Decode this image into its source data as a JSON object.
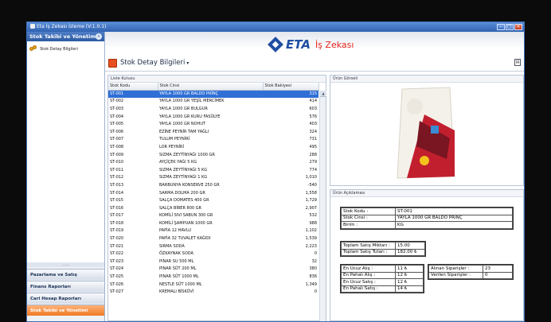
{
  "window": {
    "title": "Eta İş Zekası İzleme (V:1.0.1)"
  },
  "sidebar": {
    "title": "Stok Takibi ve Yönetimi",
    "items": [
      {
        "label": "Stok Detay Bilgileri"
      }
    ],
    "grip": "......",
    "buttons": [
      {
        "label": "Pazarlama ve Satış"
      },
      {
        "label": "Finans Raporları"
      },
      {
        "label": "Cari Hesap Raporları"
      },
      {
        "label": "Stok Takibi ve Yönetimi"
      }
    ]
  },
  "header": {
    "brand": "ETA",
    "tagline": "İş Zekası"
  },
  "page": {
    "title": "Stok Detay Bilgileri"
  },
  "list": {
    "title": "Liste Kutusu",
    "columns": [
      "Stok Kodu",
      "Stok Cinsi",
      "Stok Bakiyesi"
    ],
    "rows": [
      [
        "ST-001",
        "YAYLA 1000 GR BALDO PRİNÇ",
        "315"
      ],
      [
        "ST-002",
        "YAYLA 1000 GR YEŞİL MERCİMEK",
        "414"
      ],
      [
        "ST-003",
        "YAYLA 1000 GR BULGUR",
        "603"
      ],
      [
        "ST-004",
        "YAYLA 1000 GR KURU FASÜLYE",
        "576"
      ],
      [
        "ST-005",
        "YAYLA 1000 GR NOHUT",
        "403"
      ],
      [
        "ST-006",
        "EZİNE PEYNİR TAM YAĞLI",
        "324"
      ],
      [
        "ST-007",
        "TULUM PEYNİRİ",
        "731"
      ],
      [
        "ST-008",
        "LOR PEYNİRİ",
        "495"
      ],
      [
        "ST-009",
        "SIZMA ZEYTİNYAĞI 1000 GR",
        "288"
      ],
      [
        "ST-010",
        "AYÇİÇEK YAĞI 5 KG",
        "279"
      ],
      [
        "ST-011",
        "SIZMA ZEYTİNYAĞI 5 KG",
        "774"
      ],
      [
        "ST-012",
        "SIZMA ZEYTİNYAĞI 1 KG",
        "1,010"
      ],
      [
        "ST-013",
        "BARBUNYA KONSERVE 250 GR",
        "-540"
      ],
      [
        "ST-014",
        "SARMA DOLMA 200 GR",
        "1,558"
      ],
      [
        "ST-015",
        "SALÇA DOMATES  400 GR",
        "1,729"
      ],
      [
        "ST-016",
        "SALÇA BİBER 800 GR",
        "2,907"
      ],
      [
        "ST-017",
        "KOMİLİ SIVI SABUN 300 GR",
        "532"
      ],
      [
        "ST-018",
        "KOMİLİ ŞAMPUAN  1000 GR",
        "988"
      ],
      [
        "ST-019",
        "PAPİA 12 HAVLU",
        "1,102"
      ],
      [
        "ST-020",
        "PAPİA 32 TUVALET KAĞIDI",
        "1,539"
      ],
      [
        "ST-021",
        "SIRMA SODA",
        "2,223"
      ],
      [
        "ST-022",
        "ÖZKAYNAK SODA",
        "0"
      ],
      [
        "ST-023",
        "PINAR SU 500 ML",
        "32"
      ],
      [
        "ST-024",
        "PINAR SÜT 200 ML",
        "380"
      ],
      [
        "ST-025",
        "PINAR SÜT 1000 ML",
        "836"
      ],
      [
        "ST-026",
        "NESTLE SÜT 1000 ML",
        "1,349"
      ],
      [
        "ST-027",
        "KREMALI BİSKÜVİ",
        "0"
      ]
    ]
  },
  "image_panel": {
    "title": "Ürün Görseli"
  },
  "desc_panel": {
    "title": "Ürün Açıklaması",
    "info": [
      [
        "Stok Kodu :",
        "ST-001"
      ],
      [
        "Stok Cinsi :",
        "YAYLA 1000 GR BALDO PRİNÇ"
      ],
      [
        "Birim :",
        "KG"
      ]
    ],
    "sales": [
      [
        "Toplam Satış Miktarı :",
        "15.00"
      ],
      [
        "Toplam Satış Tutarı :",
        "182.00 ₺"
      ]
    ],
    "prices": [
      [
        "En Ucuz Alış :",
        "11 ₺"
      ],
      [
        "En Pahalı Alış :",
        "12 ₺"
      ],
      [
        "En Ucuz Satış :",
        "12 ₺"
      ],
      [
        "En Pahalı Satış :",
        "14 ₺"
      ]
    ],
    "orders": [
      [
        "Alınan Siparişler :",
        "23"
      ],
      [
        "Verilen Siparişler :",
        "0"
      ]
    ]
  },
  "colors": {
    "accent": "#2f6fd6",
    "brand": "#1f4ea1",
    "tagline": "#e2231a",
    "active_tab": "#f07a22"
  }
}
